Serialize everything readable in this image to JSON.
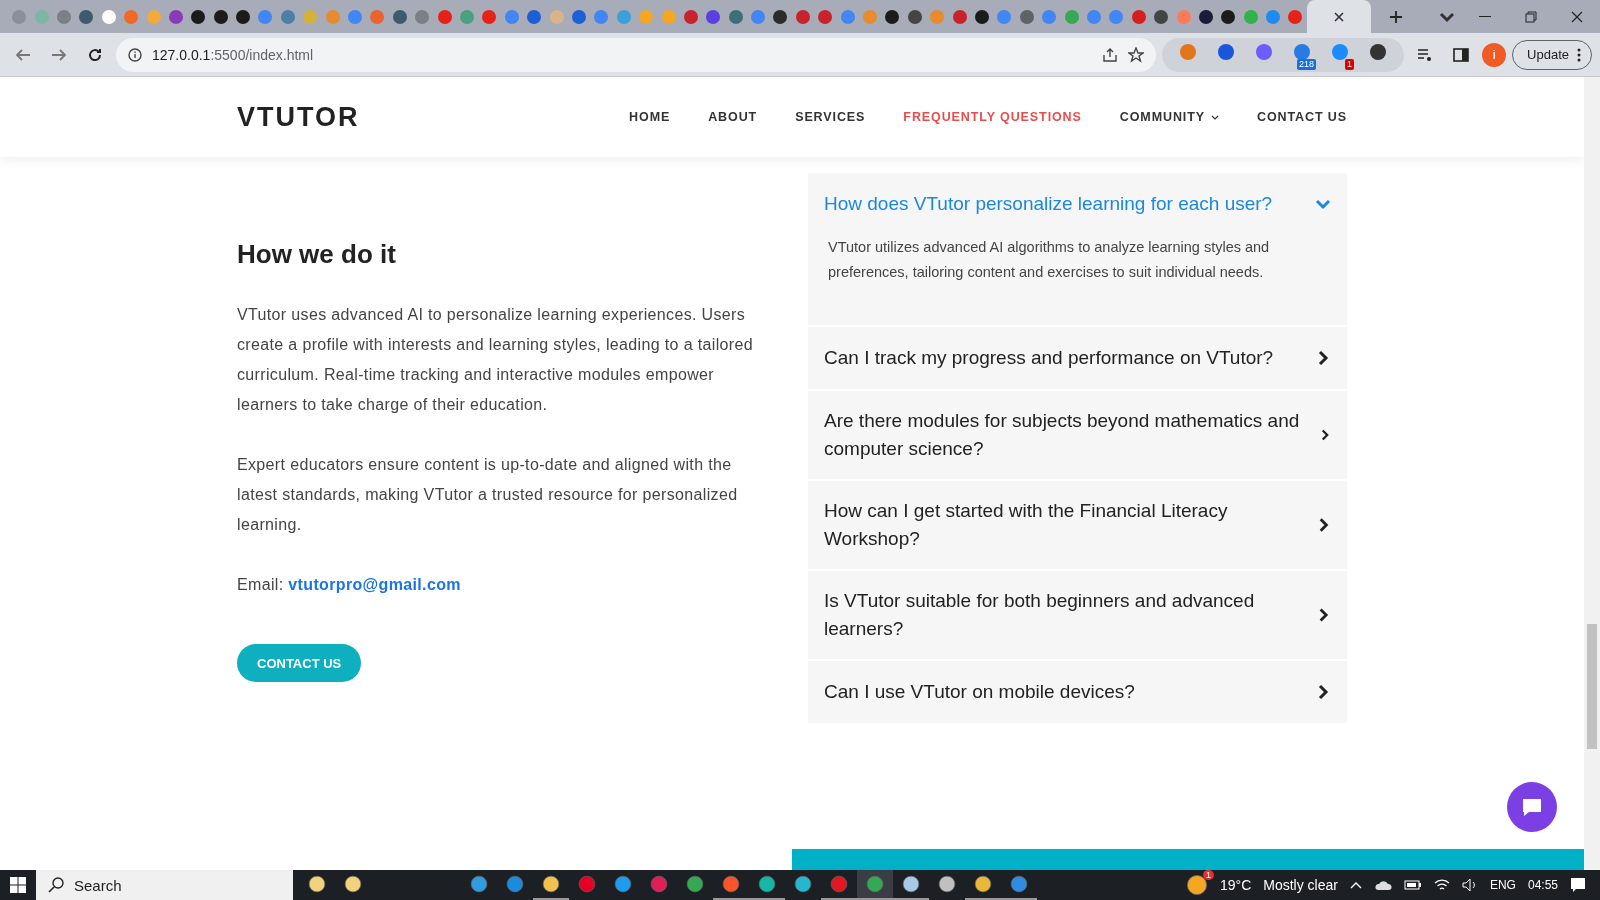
{
  "browser": {
    "tabs": [
      {
        "color": "#8a8f99",
        "selected": false
      },
      {
        "color": "#7fb5a8",
        "selected": false
      },
      {
        "color": "#7b7f86",
        "selected": false
      },
      {
        "color": "#3d5a6e",
        "selected": false
      },
      {
        "color": "#ffffff",
        "selected": false
      },
      {
        "color": "#f06a26",
        "selected": false
      },
      {
        "color": "#f3a93c",
        "selected": false
      },
      {
        "color": "#8a3ab9",
        "selected": false
      },
      {
        "color": "#1b1b1b",
        "selected": false
      },
      {
        "color": "#1b1b1b",
        "selected": false
      },
      {
        "color": "#1b1b1b",
        "selected": false
      },
      {
        "color": "#4285f4",
        "selected": false
      },
      {
        "color": "#4d7fa8",
        "selected": false
      },
      {
        "color": "#d4b23a",
        "selected": false
      },
      {
        "color": "#e88b2e",
        "selected": false
      },
      {
        "color": "#4285f4",
        "selected": false
      },
      {
        "color": "#e8632e",
        "selected": false
      },
      {
        "color": "#3d5a6e",
        "selected": false
      },
      {
        "color": "#7b7f86",
        "selected": false
      },
      {
        "color": "#e62117",
        "selected": false
      },
      {
        "color": "#4aa182",
        "selected": false
      },
      {
        "color": "#e62117",
        "selected": false
      },
      {
        "color": "#4285f4",
        "selected": false
      },
      {
        "color": "#1c5fd6",
        "selected": false
      },
      {
        "color": "#d9b48a",
        "selected": false
      },
      {
        "color": "#1c5fd6",
        "selected": false
      },
      {
        "color": "#4285f4",
        "selected": false
      },
      {
        "color": "#3aa0d8",
        "selected": false
      },
      {
        "color": "#f5a623",
        "selected": false
      },
      {
        "color": "#f5a623",
        "selected": false
      },
      {
        "color": "#c8232c",
        "selected": false
      },
      {
        "color": "#5b3fe0",
        "selected": false
      },
      {
        "color": "#3d6f7a",
        "selected": false
      },
      {
        "color": "#4285f4",
        "selected": false
      },
      {
        "color": "#2b2b2b",
        "selected": false
      },
      {
        "color": "#c8232c",
        "selected": false
      },
      {
        "color": "#c8232c",
        "selected": false
      },
      {
        "color": "#4285f4",
        "selected": false
      },
      {
        "color": "#e88b2e",
        "selected": false
      },
      {
        "color": "#1b1b1b",
        "selected": false
      },
      {
        "color": "#444444",
        "selected": false
      },
      {
        "color": "#e88b2e",
        "selected": false
      },
      {
        "color": "#c8232c",
        "selected": false
      },
      {
        "color": "#1b1b1b",
        "selected": false
      },
      {
        "color": "#4285f4",
        "selected": false
      },
      {
        "color": "#5f6368",
        "selected": false
      },
      {
        "color": "#4285f4",
        "selected": false
      },
      {
        "color": "#34a853",
        "selected": false
      },
      {
        "color": "#4285f4",
        "selected": false
      },
      {
        "color": "#4285f4",
        "selected": false
      },
      {
        "color": "#d41f1f",
        "selected": false
      },
      {
        "color": "#444444",
        "selected": false
      },
      {
        "color": "#ff7a59",
        "selected": false
      },
      {
        "color": "#1b1b3a",
        "selected": false
      },
      {
        "color": "#1b1b1b",
        "selected": false
      },
      {
        "color": "#2fb34a",
        "selected": false
      },
      {
        "color": "#1d8cf0",
        "selected": false
      },
      {
        "color": "#e62117",
        "selected": false
      },
      {
        "selected": true
      }
    ],
    "url_host": "127.0.0.1",
    "url_path": ":5500/index.html",
    "extensions": [
      {
        "color": "#e2761b"
      },
      {
        "color": "#1a56db"
      },
      {
        "color": "#6d5dfc"
      },
      {
        "color": "#2a7ae4",
        "badge": "218"
      },
      {
        "color": "#1a8cff",
        "badge": "1"
      },
      {
        "color": "#333333"
      }
    ],
    "profile": "i",
    "update": "Update"
  },
  "site": {
    "logo": "VTUTOR",
    "nav": [
      {
        "label": "HOME",
        "selected": false,
        "dropdown": false
      },
      {
        "label": "ABOUT",
        "selected": false,
        "dropdown": false
      },
      {
        "label": "SERVICES",
        "selected": false,
        "dropdown": false
      },
      {
        "label": "FREQUENTLY QUESTIONS",
        "selected": true,
        "dropdown": false
      },
      {
        "label": "COMMUNITY",
        "selected": false,
        "dropdown": true
      },
      {
        "label": "CONTACT US",
        "selected": false,
        "dropdown": false
      }
    ],
    "heading": "How we do it",
    "paragraphs": [
      "VTutor uses advanced AI to personalize learning experiences. Users create a profile with interests and learning styles, leading to a tailored curriculum. Real-time tracking and interactive modules empower learners to take charge of their education.",
      "Expert educators ensure content is up-to-date and aligned with the latest standards, making VTutor a trusted resource for personalized learning."
    ],
    "email_label": "Email:",
    "email": "vtutorpro@gmail.com",
    "contact_button": "CONTACT US",
    "faq": [
      {
        "question": "How does VTutor personalize learning for each user?",
        "expanded": true,
        "answer": "VTutor utilizes advanced AI algorithms to analyze learning styles and preferences, tailoring content and exercises to suit individual needs."
      },
      {
        "question": "Can I track my progress and performance on VTutor?",
        "expanded": false
      },
      {
        "question": "Are there modules for subjects beyond mathematics and computer science?",
        "expanded": false
      },
      {
        "question": "How can I get started with the Financial Literacy Workshop?",
        "expanded": false
      },
      {
        "question": "Is VTutor suitable for both beginners and advanced learners?",
        "expanded": false
      },
      {
        "question": "Can I use VTutor on mobile devices?",
        "expanded": false
      }
    ]
  },
  "taskbar": {
    "search_placeholder": "Search",
    "apps": [
      {
        "color": "#f2d27a",
        "running": false,
        "selected": false
      },
      {
        "color": "#f2d27a",
        "running": false,
        "selected": false
      },
      {
        "color": "#2f9de0",
        "running": false,
        "selected": false
      },
      {
        "color": "#1a8ce0",
        "running": false,
        "selected": false
      },
      {
        "color": "#f2c14e",
        "running": true,
        "selected": false
      },
      {
        "color": "#e60023",
        "running": false,
        "selected": false
      },
      {
        "color": "#1d9bf0",
        "running": false,
        "selected": false
      },
      {
        "color": "#e01e5a",
        "running": false,
        "selected": false
      },
      {
        "color": "#34a853",
        "running": false,
        "selected": false
      },
      {
        "color": "#fb542b",
        "running": true,
        "selected": false
      },
      {
        "color": "#14b8a6",
        "running": true,
        "selected": false
      },
      {
        "color": "#22b8cf",
        "running": false,
        "selected": false
      },
      {
        "color": "#e0181f",
        "running": true,
        "selected": false
      },
      {
        "color": "#34a853",
        "running": true,
        "selected": true
      },
      {
        "color": "#a8c8e8",
        "running": true,
        "selected": false
      },
      {
        "color": "#c0c0c0",
        "running": false,
        "selected": false
      },
      {
        "color": "#e8b838",
        "running": true,
        "selected": false
      },
      {
        "color": "#2f8ce0",
        "running": true,
        "selected": false
      }
    ],
    "weather_badge": "1",
    "temperature": "19°C",
    "condition": "Mostly clear",
    "language": "ENG",
    "time": "04:55"
  }
}
